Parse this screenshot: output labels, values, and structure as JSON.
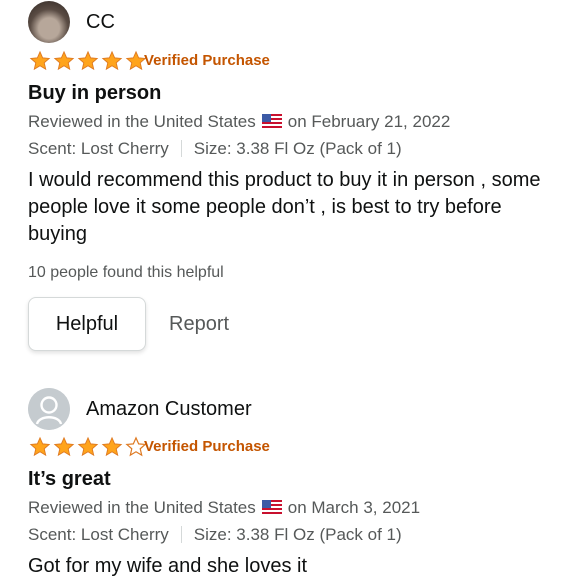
{
  "reviews": [
    {
      "reviewer": "CC",
      "rating": 5,
      "verified": "Verified Purchase",
      "title": "Buy in person",
      "reviewed_in": "Reviewed in the United States",
      "date": "on February 21, 2022",
      "scent": "Scent: Lost Cherry",
      "size": "Size: 3.38 Fl Oz (Pack of 1)",
      "body": "I would recommend this product to buy it in person , some people love it some people don’t , is best to try before buying",
      "helpful_count": "10 people found this helpful",
      "helpful_label": "Helpful",
      "report_label": "Report"
    },
    {
      "reviewer": "Amazon Customer",
      "rating": 4,
      "verified": "Verified Purchase",
      "title": "It’s great",
      "reviewed_in": "Reviewed in the United States",
      "date": "on March 3, 2021",
      "scent": "Scent: Lost Cherry",
      "size": "Size: 3.38 Fl Oz (Pack of 1)",
      "body": "Got for my wife and she loves it"
    }
  ],
  "colors": {
    "star": "#ffa41c",
    "star_outline": "#de7921",
    "verified": "#c45500",
    "meta": "#565959"
  },
  "icons": {
    "flag": "us-flag-icon",
    "default_avatar": "person-avatar-icon"
  }
}
